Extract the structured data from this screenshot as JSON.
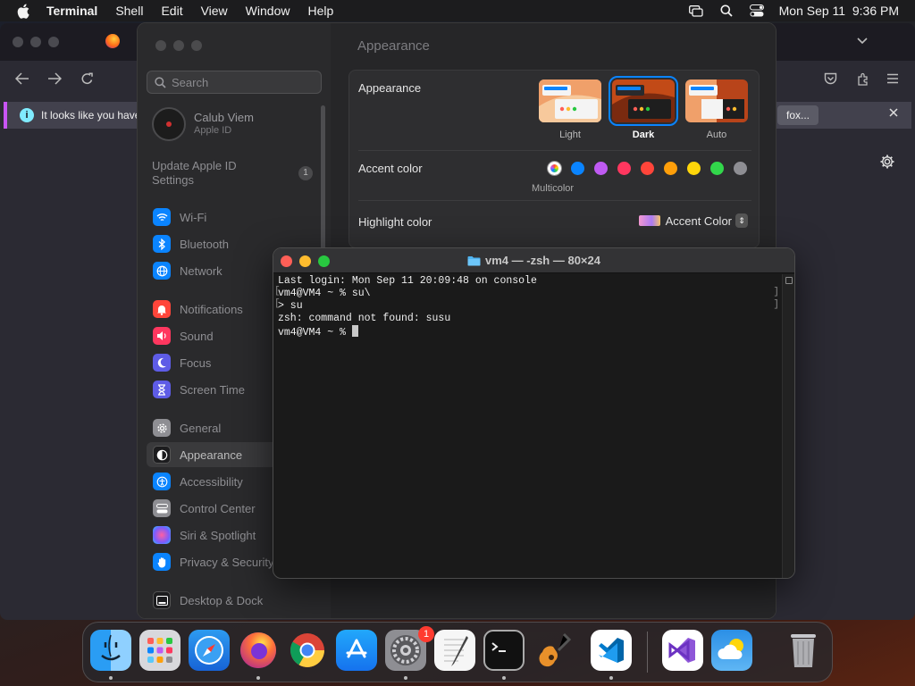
{
  "menubar": {
    "app": "Terminal",
    "items": [
      "Shell",
      "Edit",
      "View",
      "Window",
      "Help"
    ],
    "datetime": "Mon Sep 11  9:36 PM"
  },
  "browser": {
    "notice_text": "It looks like you haven",
    "notice_button": "fox..."
  },
  "settings": {
    "search_placeholder": "Search",
    "account": {
      "name": "Calub Viem",
      "subtitle": "Apple ID"
    },
    "update": {
      "label": "Update Apple ID Settings",
      "badge": "1"
    },
    "sidebar_items": [
      {
        "label": "Wi-Fi",
        "icon": "wifi-icon",
        "color": "#0a84ff"
      },
      {
        "label": "Bluetooth",
        "icon": "bluetooth-icon",
        "color": "#0a84ff"
      },
      {
        "label": "Network",
        "icon": "globe-icon",
        "color": "#0a84ff"
      },
      {
        "label": "Notifications",
        "icon": "bell-icon",
        "color": "#ff453a"
      },
      {
        "label": "Sound",
        "icon": "speaker-icon",
        "color": "#ff375f"
      },
      {
        "label": "Focus",
        "icon": "moon-icon",
        "color": "#5e5ce6"
      },
      {
        "label": "Screen Time",
        "icon": "hourglass-icon",
        "color": "#5e5ce6"
      },
      {
        "label": "General",
        "icon": "gear-icon",
        "color": "#8e8e93"
      },
      {
        "label": "Appearance",
        "icon": "appearance-icon",
        "color": "#1c1c1e"
      },
      {
        "label": "Accessibility",
        "icon": "accessibility-icon",
        "color": "#0a84ff"
      },
      {
        "label": "Control Center",
        "icon": "control-center-icon",
        "color": "#8e8e93"
      },
      {
        "label": "Siri & Spotlight",
        "icon": "siri-icon",
        "color": "#bf5af2"
      },
      {
        "label": "Privacy & Security",
        "icon": "hand-icon",
        "color": "#0a84ff"
      },
      {
        "label": "Desktop & Dock",
        "icon": "dock-icon",
        "color": "#1c1c1e"
      }
    ],
    "page_title": "Appearance",
    "appearance": {
      "label": "Appearance",
      "options": [
        "Light",
        "Dark",
        "Auto"
      ],
      "selected": "Dark"
    },
    "accent": {
      "label": "Accent color",
      "selected_label": "Multicolor",
      "colors": [
        "#0a84ff",
        "#bf5af2",
        "#ff375f",
        "#ff453a",
        "#ff9f0a",
        "#ffd60a",
        "#32d74b",
        "#8e8e93"
      ]
    },
    "highlight": {
      "label": "Highlight color",
      "value": "Accent Color"
    }
  },
  "terminal": {
    "title": "vm4 — -zsh — 80×24",
    "lines": [
      "Last login: Mon Sep 11 20:09:48 on console",
      "vm4@VM4 ~ % su\\",
      "> su",
      "zsh: command not found: susu",
      "vm4@VM4 ~ % "
    ]
  },
  "dock": {
    "apps": [
      "Finder",
      "Launchpad",
      "Safari",
      "Firefox",
      "Chrome",
      "App Store",
      "System Settings",
      "TextEdit",
      "Terminal",
      "GarageBand",
      "VS Code",
      "Visual Studio",
      "Weather",
      "Trash"
    ],
    "settings_badge": "1"
  }
}
